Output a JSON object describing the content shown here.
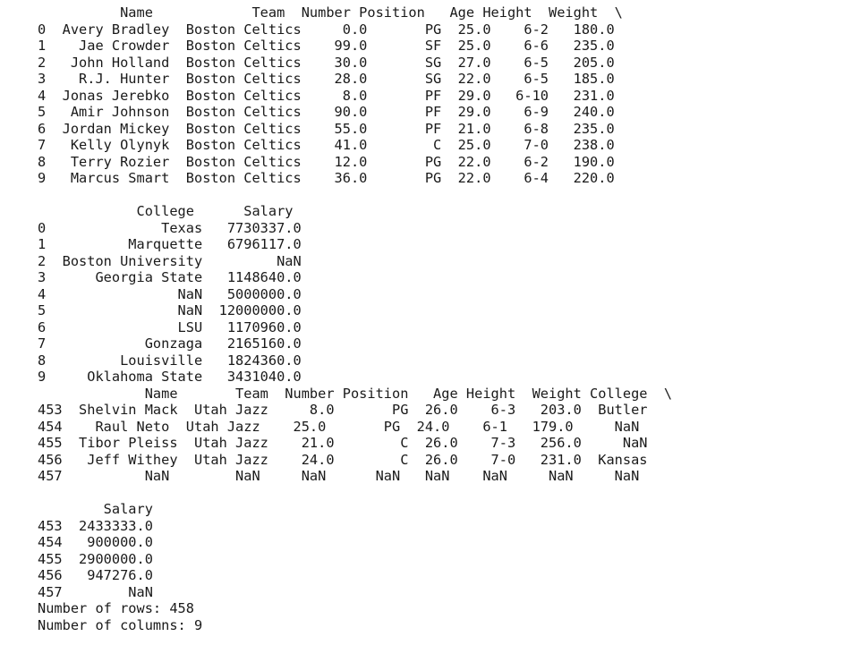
{
  "console": {
    "lines": [
      "          Name            Team  Number Position   Age Height  Weight  \\",
      "0  Avery Bradley  Boston Celtics     0.0       PG  25.0    6-2   180.0   ",
      "1    Jae Crowder  Boston Celtics    99.0       SF  25.0    6-6   235.0   ",
      "2   John Holland  Boston Celtics    30.0       SG  27.0    6-5   205.0   ",
      "3    R.J. Hunter  Boston Celtics    28.0       SG  22.0    6-5   185.0   ",
      "4  Jonas Jerebko  Boston Celtics     8.0       PF  29.0   6-10   231.0   ",
      "5   Amir Johnson  Boston Celtics    90.0       PF  29.0    6-9   240.0   ",
      "6  Jordan Mickey  Boston Celtics    55.0       PF  21.0    6-8   235.0   ",
      "7   Kelly Olynyk  Boston Celtics    41.0        C  25.0    7-0   238.0   ",
      "8   Terry Rozier  Boston Celtics    12.0       PG  22.0    6-2   190.0   ",
      "9   Marcus Smart  Boston Celtics    36.0       PG  22.0    6-4   220.0   ",
      "",
      "            College      Salary  ",
      "0              Texas   7730337.0  ",
      "1          Marquette   6796117.0  ",
      "2  Boston University         NaN  ",
      "3      Georgia State   1148640.0  ",
      "4                NaN   5000000.0  ",
      "5                NaN  12000000.0  ",
      "6                LSU   1170960.0  ",
      "7            Gonzaga   2165160.0  ",
      "8         Louisville   1824360.0  ",
      "9     Oklahoma State   3431040.0  ",
      "             Name       Team  Number Position   Age Height  Weight College  \\",
      "453  Shelvin Mack  Utah Jazz     8.0       PG  26.0    6-3   203.0  Butler   ",
      "454    Raul Neto  Utah Jazz    25.0       PG  24.0    6-1   179.0     NaN   ",
      "455  Tibor Pleiss  Utah Jazz    21.0        C  26.0    7-3   256.0     NaN   ",
      "456   Jeff Withey  Utah Jazz    24.0        C  26.0    7-0   231.0  Kansas   ",
      "457          NaN        NaN     NaN      NaN   NaN    NaN     NaN     NaN   ",
      "",
      "        Salary  ",
      "453  2433333.0  ",
      "454   900000.0  ",
      "455  2900000.0  ",
      "456   947276.0  ",
      "457        NaN  ",
      "Number of rows: 458",
      "Number of columns: 9"
    ]
  }
}
